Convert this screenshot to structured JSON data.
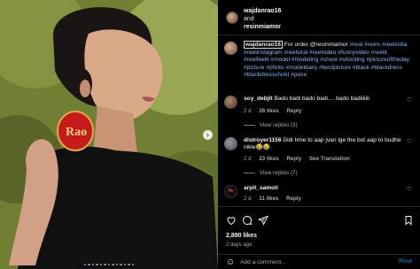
{
  "header": {
    "username_primary": "wajdanrao16",
    "conjunction": "and",
    "username_secondary": "resinmiamor"
  },
  "caption": {
    "username": "wajdanrao16",
    "text": "For order @resinmiamor",
    "hashtags": "#real #reels #reelindia #reelinstagram #reelviral #reelvideo #funnyvideo #reelit #reelfeelit #model #modeling #shoot #shooting #pictureoftheday #picture #photo #modeldairy #bestpicture #black #blackdress #blackdressshoot #pose"
  },
  "comments": [
    {
      "username": "soy_debjit",
      "text": "Bado badi bado badi.... bado badiiiiiii",
      "time": "2 d",
      "likes": "26 likes",
      "reply": "Reply",
      "view_replies": "View replies (3)"
    },
    {
      "username": "distroyer1156",
      "text": "Didi hme to aap jvan lge the but aap to budhe nikle😂😂",
      "time": "2 d",
      "likes": "23 likes",
      "reply": "Reply",
      "translation": "See Translation",
      "view_replies": "View replies (7)"
    },
    {
      "username": "arpit_samoli",
      "text": "",
      "time": "2 d",
      "likes": "11 likes",
      "reply": "Reply"
    }
  ],
  "actions": {
    "likes": "2,890 likes",
    "date": "2 days ago",
    "add_comment_placeholder": "Add a comment...",
    "post_label": "Post"
  },
  "photo": {
    "earring_text": "Rao",
    "carousel_total": 13,
    "carousel_active": 1
  },
  "icons": {
    "like": "heart-icon",
    "comment": "comment-icon",
    "share": "share-icon",
    "save": "bookmark-icon",
    "more": "more-icon",
    "emoji": "emoji-icon",
    "next": "chevron-right-icon"
  },
  "colors": {
    "background": "#000000",
    "hashtag": "#8ab4f8",
    "post_button": "#1e6fb8",
    "carousel_active": "#4aa8ff"
  }
}
